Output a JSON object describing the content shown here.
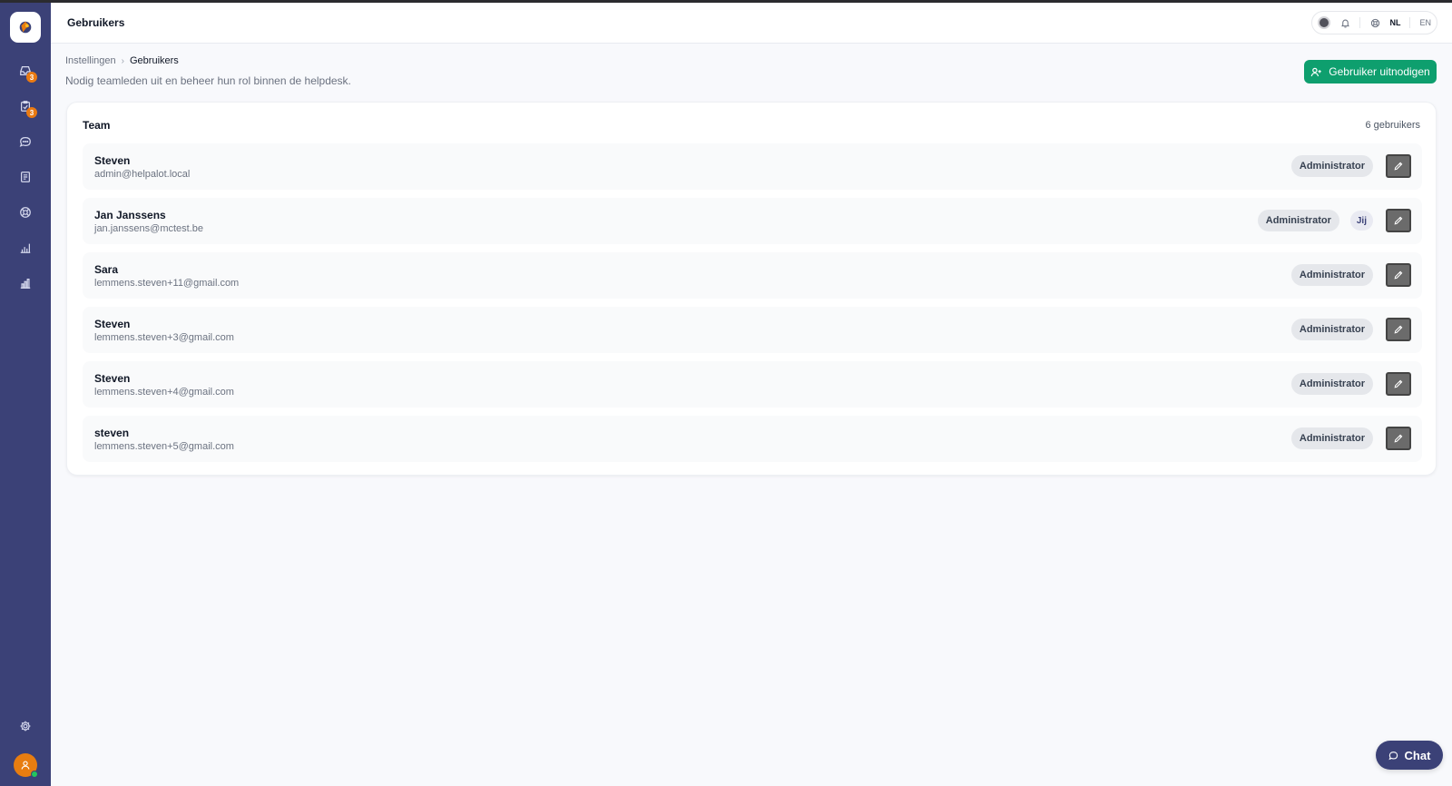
{
  "header": {
    "title": "Gebruikers",
    "languages": [
      {
        "code": "NL",
        "active": true
      },
      {
        "code": "EN",
        "active": false
      }
    ]
  },
  "sidebar": {
    "items": [
      {
        "icon": "inbox-icon",
        "badge": "3"
      },
      {
        "icon": "clipboard-icon",
        "badge": "3"
      },
      {
        "icon": "chat-bubble-icon",
        "badge": null
      },
      {
        "icon": "document-icon",
        "badge": null
      },
      {
        "icon": "lifebuoy-icon",
        "badge": null
      },
      {
        "icon": "chart-icon",
        "badge": null
      },
      {
        "icon": "bar-chart-icon",
        "badge": null
      }
    ],
    "bottom": [
      "gear-icon",
      "user-avatar"
    ]
  },
  "breadcrumb": {
    "parent": "Instellingen",
    "current": "Gebruikers"
  },
  "page": {
    "subtitle": "Nodig teamleden uit en beheer hun rol binnen de helpdesk.",
    "invite_label": "Gebruiker uitnodigen"
  },
  "team": {
    "title": "Team",
    "count": "6 gebruikers",
    "users": [
      {
        "name": "Steven",
        "email": "admin@helpalot.local",
        "role": "Administrator",
        "you": null
      },
      {
        "name": "Jan Janssens",
        "email": "jan.janssens@mctest.be",
        "role": "Administrator",
        "you": "Jij"
      },
      {
        "name": "Sara",
        "email": "lemmens.steven+11@gmail.com",
        "role": "Administrator",
        "you": null
      },
      {
        "name": "Steven",
        "email": "lemmens.steven+3@gmail.com",
        "role": "Administrator",
        "you": null
      },
      {
        "name": "Steven",
        "email": "lemmens.steven+4@gmail.com",
        "role": "Administrator",
        "you": null
      },
      {
        "name": "steven",
        "email": "lemmens.steven+5@gmail.com",
        "role": "Administrator",
        "you": null
      }
    ]
  },
  "chat": {
    "label": "Chat"
  },
  "colors": {
    "sidebar": "#3b4177",
    "primary_button": "#0e9f6e",
    "badge": "#ea7a12",
    "avatar": "#e87d10"
  }
}
